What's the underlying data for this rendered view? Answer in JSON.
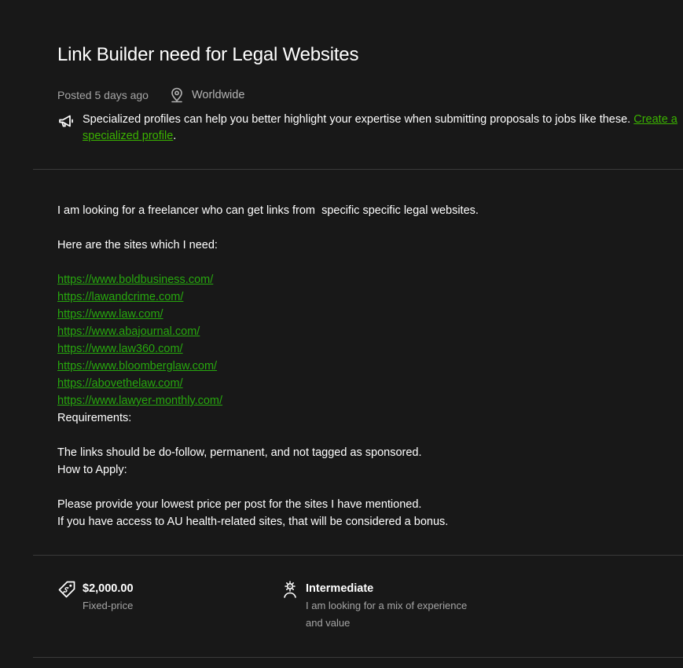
{
  "job": {
    "title": "Link Builder need for Legal Websites",
    "posted": "Posted 5 days ago",
    "location": "Worldwide"
  },
  "tip": {
    "text": "Specialized profiles can help you better highlight your expertise when submitting proposals to jobs like these.",
    "link_label": "Create a specialized profile",
    "suffix": "."
  },
  "description": {
    "intro": "I am looking for a freelancer who can get links from  specific specific legal websites.",
    "sites_heading": "Here are the sites which I need:",
    "sites": [
      "https://www.boldbusiness.com/",
      "https://lawandcrime.com/",
      "https://www.law.com/",
      "https://www.abajournal.com/",
      "https://www.law360.com/",
      "https://www.bloomberglaw.com/",
      "https://abovethelaw.com/",
      "https://www.lawyer-monthly.com/"
    ],
    "requirements_heading": "Requirements:",
    "requirements": "The links should be do-follow, permanent, and not tagged as sponsored.",
    "apply_heading": "How to Apply:",
    "apply_line1": "Please provide your lowest price per post for the sites I have mentioned.",
    "apply_line2": "If you have access to AU health-related sites, that will be considered a bonus."
  },
  "features": {
    "price": {
      "value": "$2,000.00",
      "label": "Fixed-price",
      "icon": "price-tag-icon"
    },
    "level": {
      "value": "Intermediate",
      "label_line1": "I am looking for a mix of experience",
      "label_line2": "and value",
      "icon": "experience-level-icon"
    }
  },
  "colors": {
    "background": "#181818",
    "link": "#14a800",
    "muted": "#a5a5a5",
    "divider": "#3a3a3a"
  }
}
